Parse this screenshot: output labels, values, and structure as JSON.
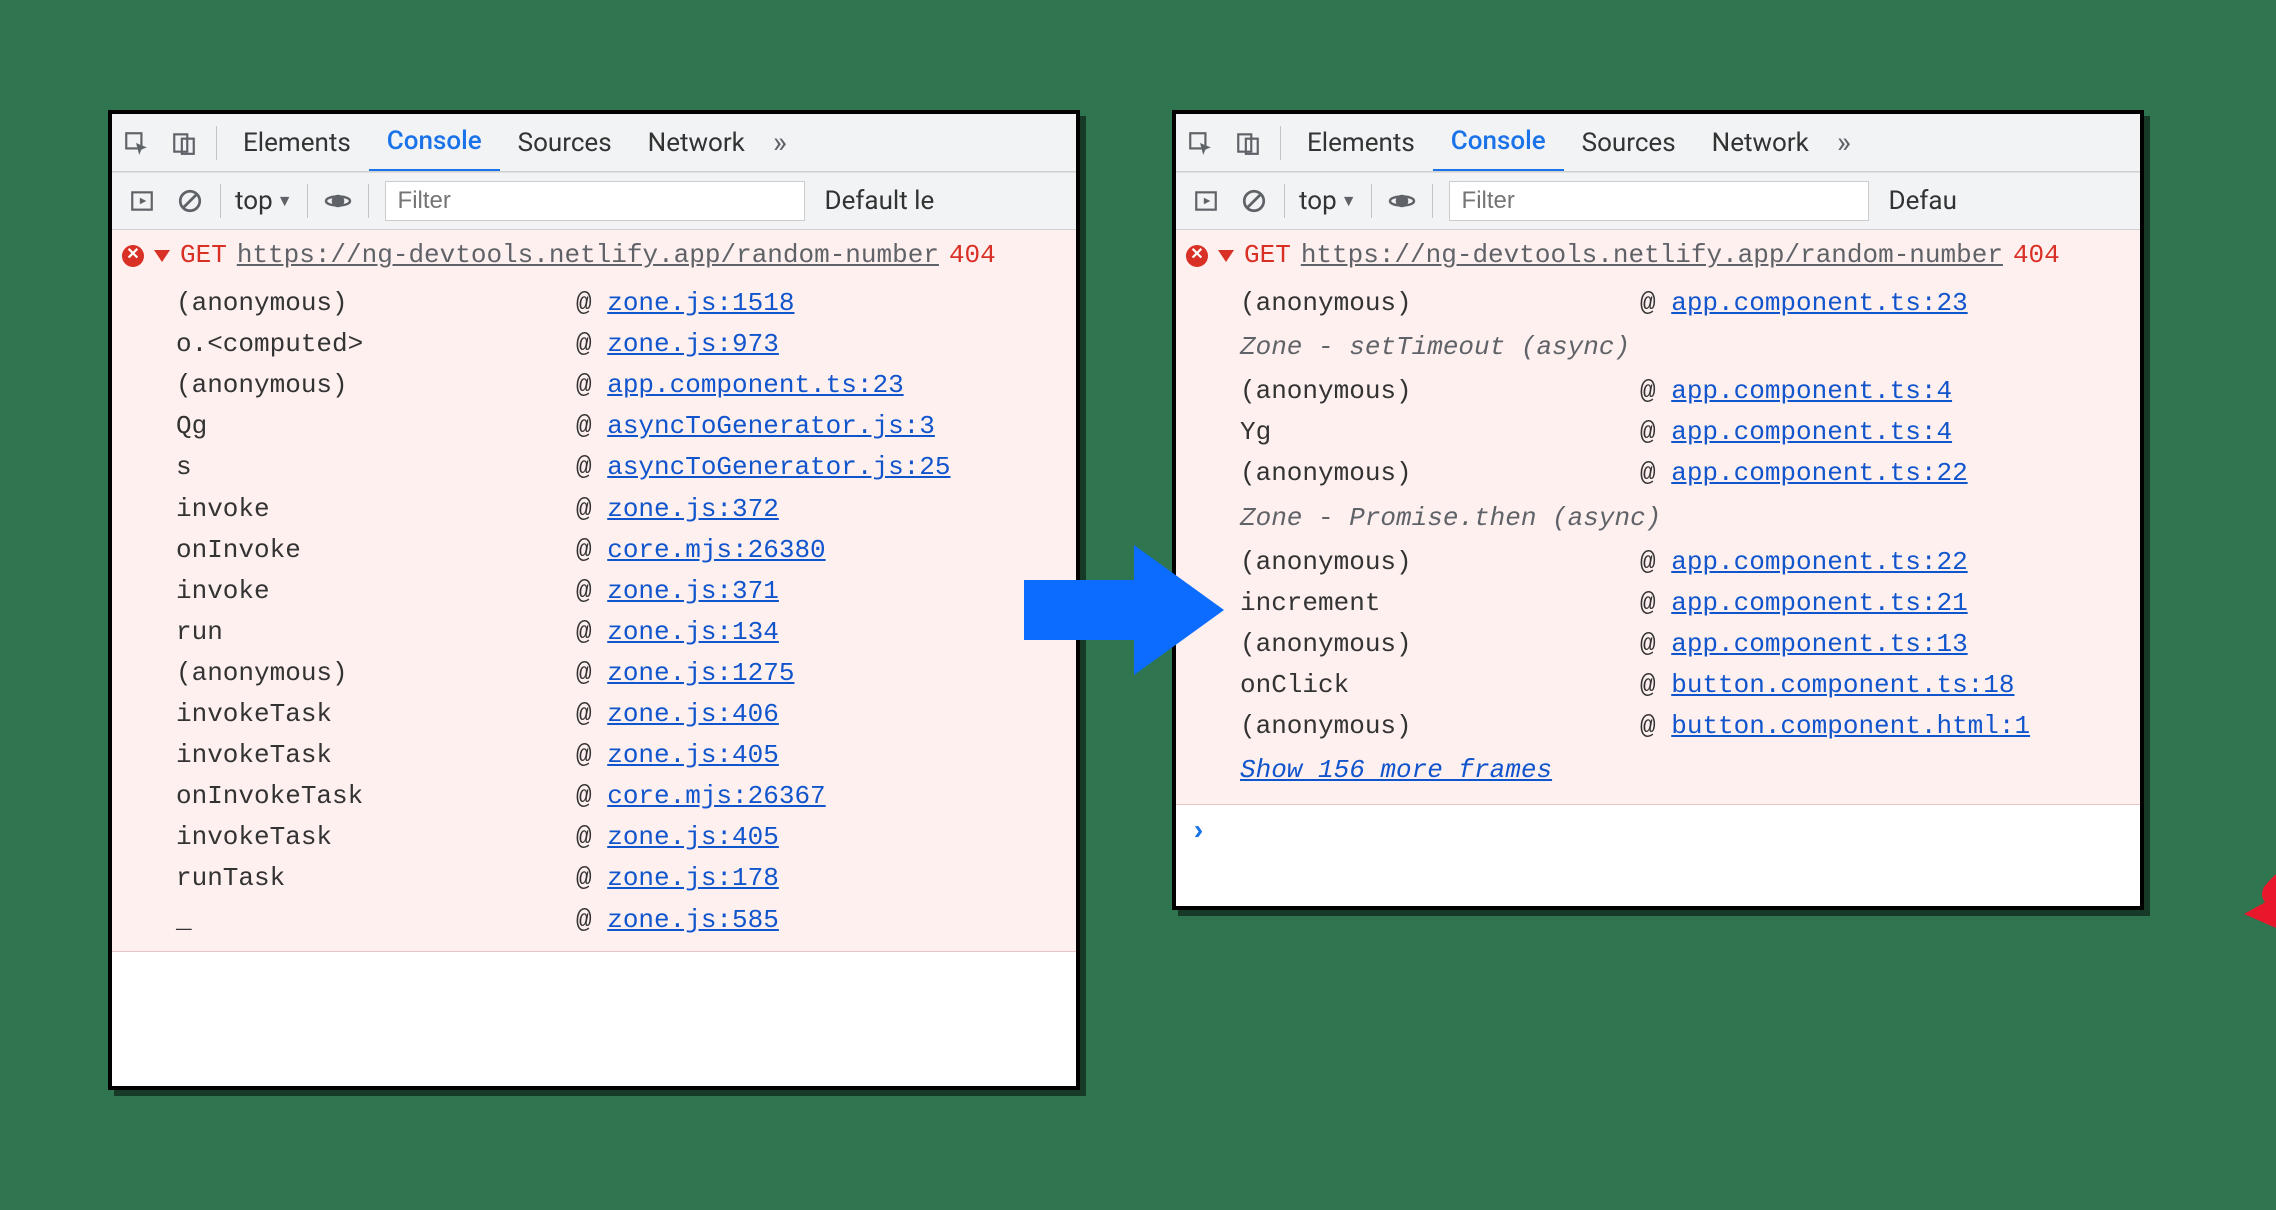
{
  "tabbar": {
    "tabs": [
      "Elements",
      "Console",
      "Sources",
      "Network"
    ],
    "active": "Console",
    "more": "»"
  },
  "filterbar": {
    "context": "top",
    "tri": "▼",
    "filter_placeholder": "Filter",
    "levels_left": "Default le",
    "levels_right": "Defau"
  },
  "left": {
    "method": "GET",
    "url": "https://ng-devtools.netlify.app/random-number",
    "status": "404",
    "frames": [
      {
        "fn": "(anonymous)",
        "loc": "zone.js:1518"
      },
      {
        "fn": "o.<computed>",
        "loc": "zone.js:973"
      },
      {
        "fn": "(anonymous)",
        "loc": "app.component.ts:23"
      },
      {
        "fn": "Qg",
        "loc": "asyncToGenerator.js:3"
      },
      {
        "fn": "s",
        "loc": "asyncToGenerator.js:25"
      },
      {
        "fn": "invoke",
        "loc": "zone.js:372"
      },
      {
        "fn": "onInvoke",
        "loc": "core.mjs:26380"
      },
      {
        "fn": "invoke",
        "loc": "zone.js:371"
      },
      {
        "fn": "run",
        "loc": "zone.js:134"
      },
      {
        "fn": "(anonymous)",
        "loc": "zone.js:1275"
      },
      {
        "fn": "invokeTask",
        "loc": "zone.js:406"
      },
      {
        "fn": "invokeTask",
        "loc": "zone.js:405"
      },
      {
        "fn": "onInvokeTask",
        "loc": "core.mjs:26367"
      },
      {
        "fn": "invokeTask",
        "loc": "zone.js:405"
      },
      {
        "fn": "runTask",
        "loc": "zone.js:178"
      },
      {
        "fn": "_",
        "loc": "zone.js:585"
      }
    ]
  },
  "right": {
    "method": "GET",
    "url": "https://ng-devtools.netlify.app/random-number",
    "status": "404",
    "groups": [
      {
        "header": null,
        "frames": [
          {
            "fn": "(anonymous)",
            "loc": "app.component.ts:23"
          }
        ]
      },
      {
        "header": "Zone - setTimeout (async)",
        "frames": [
          {
            "fn": "(anonymous)",
            "loc": "app.component.ts:4"
          },
          {
            "fn": "Yg",
            "loc": "app.component.ts:4"
          },
          {
            "fn": "(anonymous)",
            "loc": "app.component.ts:22"
          }
        ]
      },
      {
        "header": "Zone - Promise.then (async)",
        "frames": [
          {
            "fn": "(anonymous)",
            "loc": "app.component.ts:22"
          },
          {
            "fn": "increment",
            "loc": "app.component.ts:21"
          },
          {
            "fn": "(anonymous)",
            "loc": "app.component.ts:13"
          },
          {
            "fn": "onClick",
            "loc": "button.component.ts:18"
          },
          {
            "fn": "(anonymous)",
            "loc": "button.component.html:1"
          }
        ]
      }
    ],
    "show_more": "Show 156 more frames"
  },
  "at": "@"
}
